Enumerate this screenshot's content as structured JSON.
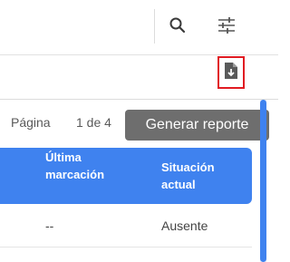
{
  "header": {
    "search_icon": "search-icon",
    "filters_icon": "tune-icon"
  },
  "toolbar": {
    "download_icon": "file-download-icon"
  },
  "pagination": {
    "label": "Página",
    "page_info": "1 de 4"
  },
  "tooltip": {
    "text": "Generar reporte"
  },
  "table": {
    "columns": [
      "Última marcación",
      "Situación actual"
    ],
    "column_lines": [
      [
        "Última",
        "marcación"
      ],
      [
        "Situación",
        "actual"
      ]
    ],
    "rows": [
      [
        "--",
        "Ausente"
      ]
    ]
  },
  "colors": {
    "accent": "#3f82ef",
    "highlight": "#e11b22",
    "tooltip_bg": "#6e6e6e"
  }
}
